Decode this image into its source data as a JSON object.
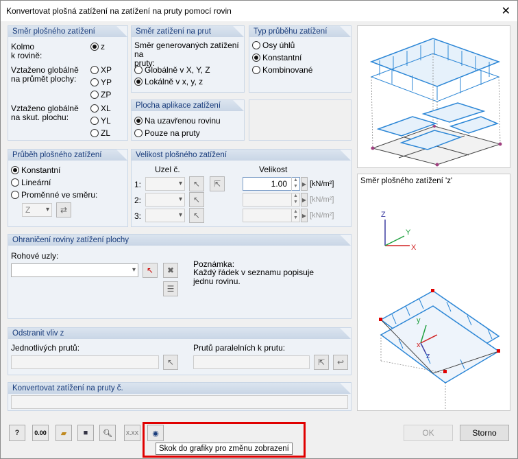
{
  "window": {
    "title": "Konvertovat plošná zatížení na zatížení na pruty pomocí rovin"
  },
  "group_direction": {
    "header": "Směr plošného zatížení",
    "kolmo": "Kolmo\nk rovině:",
    "glob_proj": "Vztaženo globálně\nna průmět plochy:",
    "glob_true": "Vztaženo globálně\nna skut. plochu:",
    "options": [
      "z",
      "XP",
      "YP",
      "ZP",
      "XL",
      "YL",
      "ZL"
    ]
  },
  "group_member_dir": {
    "header": "Směr zatížení na prut",
    "desc": "Směr generovaných zatížení na\npruty:",
    "options": [
      "Globálně v X, Y, Z",
      "Lokálně v x, y, z"
    ]
  },
  "group_type": {
    "header": "Typ průběhu zatížení",
    "options": [
      "Osy úhlů",
      "Konstantní",
      "Kombinované"
    ]
  },
  "group_apply": {
    "header": "Plocha aplikace zatížení",
    "options": [
      "Na uzavřenou rovinu",
      "Pouze na pruty"
    ]
  },
  "group_course": {
    "header": "Průběh plošného zatížení",
    "options": [
      "Konstantní",
      "Lineární",
      "Proměnné ve směru:"
    ],
    "axis": "Z"
  },
  "group_size": {
    "header": "Velikost plošného zatížení",
    "col_node": "Uzel č.",
    "col_size": "Velikost",
    "rows": [
      "1:",
      "2:",
      "3:"
    ],
    "value1": "1.00",
    "unit": "[kN/m²]"
  },
  "group_boundary": {
    "header": "Ohraničení roviny zatížení plochy",
    "corner": "Rohové uzly:",
    "note_title": "Poznámka:",
    "note_text": "Každý řádek v seznamu popisuje\njednu rovinu."
  },
  "group_remove": {
    "header": "Odstranit vliv z",
    "single": "Jednotlivých prutů:",
    "parallel": "Prutů paralelních k prutu:"
  },
  "group_convert": {
    "header": "Konvertovat zatížení na pruty č."
  },
  "preview2": {
    "caption": "Směr plošného zatížení 'z'"
  },
  "footer": {
    "tooltip": "Skok do grafiky pro změnu zobrazení",
    "ok": "OK",
    "cancel": "Storno",
    "calc_label": "0.00",
    "units_label": "X.XX"
  },
  "colors": {
    "accent": "#1a3d7c",
    "highlight": "#e00000",
    "load": "#2b86d6"
  }
}
